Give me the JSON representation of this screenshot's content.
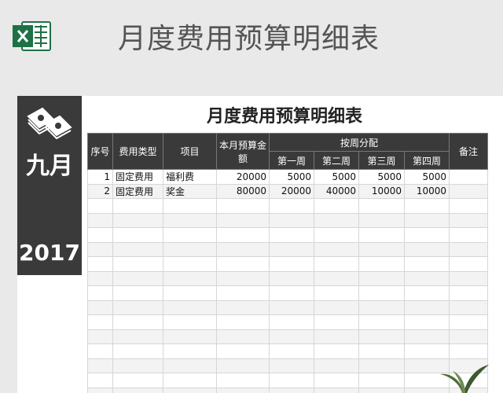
{
  "header": {
    "title": "月度费用预算明细表",
    "app_icon": "excel-icon"
  },
  "sidebar": {
    "month": "九月",
    "year": "2017",
    "icon": "money-stack-icon"
  },
  "table_title": "月度费用预算明细表",
  "columns": {
    "seq": "序号",
    "type": "费用类型",
    "item": "项目",
    "budget": "本月预算金额",
    "weekly": "按周分配",
    "w1": "第一周",
    "w2": "第二周",
    "w3": "第三周",
    "w4": "第四周",
    "note": "备注"
  },
  "rows": [
    {
      "seq": "1",
      "type": "固定费用",
      "item": "福利费",
      "budget": "20000",
      "w1": "5000",
      "w2": "5000",
      "w3": "5000",
      "w4": "5000",
      "note": ""
    },
    {
      "seq": "2",
      "type": "固定费用",
      "item": "奖金",
      "budget": "80000",
      "w1": "20000",
      "w2": "40000",
      "w3": "10000",
      "w4": "10000",
      "note": ""
    }
  ],
  "empty_rows": 14
}
